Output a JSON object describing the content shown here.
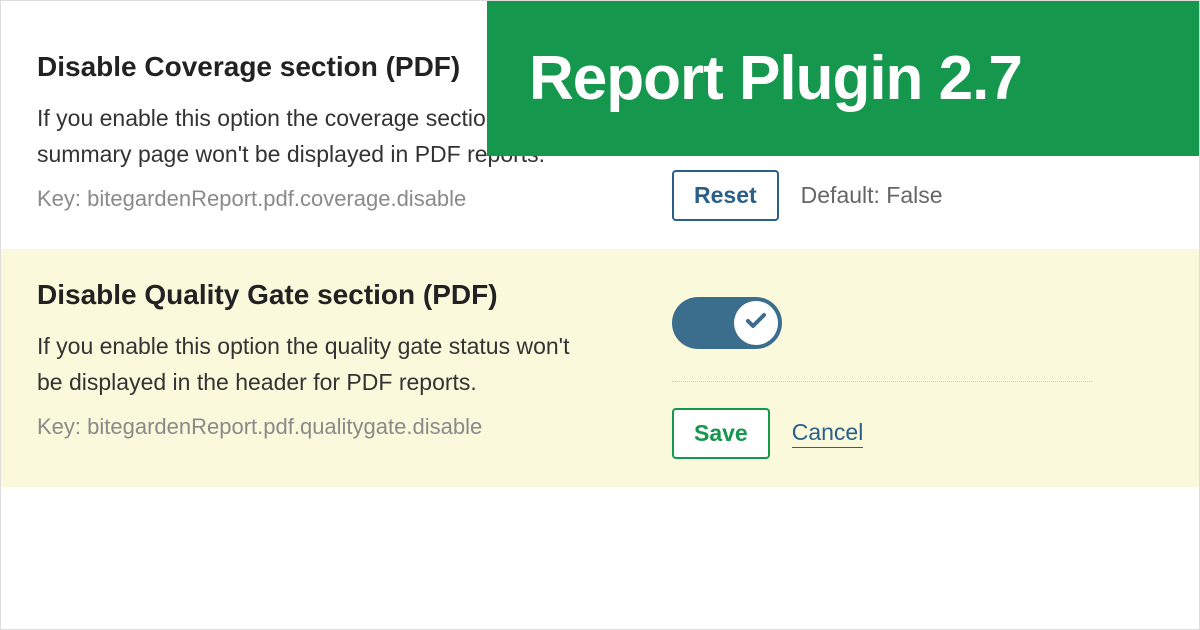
{
  "banner": {
    "title": "Report Plugin 2.7"
  },
  "settings": [
    {
      "title": "Disable Coverage section (PDF)",
      "description": "If you enable this option the coverage section in summary page won't be displayed in PDF reports.",
      "key_label": "Key: ",
      "key_value": "bitegardenReport.pdf.coverage.disable",
      "toggle_on": true,
      "reset_label": "Reset",
      "default_label": "Default: False"
    },
    {
      "title": "Disable Quality Gate section (PDF)",
      "description": "If you enable this option the quality gate status won't be displayed in the header for PDF reports.",
      "key_label": "Key: ",
      "key_value": "bitegardenReport.pdf.qualitygate.disable",
      "toggle_on": true,
      "save_label": "Save",
      "cancel_label": "Cancel"
    }
  ]
}
